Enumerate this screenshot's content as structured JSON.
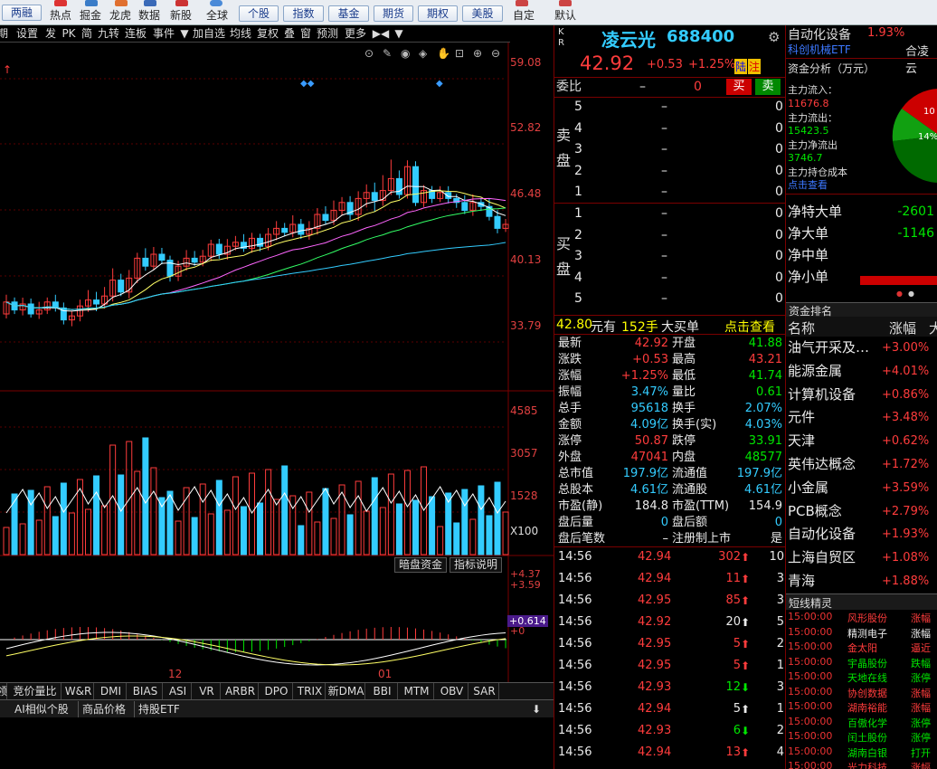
{
  "toolbar": {
    "buttons_left": [
      "两融",
      "热点",
      "掘金",
      "龙虎",
      "数据",
      "新股",
      "全球"
    ],
    "market_buttons": [
      "个股",
      "指数",
      "基金",
      "期货",
      "期权",
      "美股"
    ],
    "buttons_right": [
      "自定",
      "默认"
    ]
  },
  "chart_tabs": [
    "期",
    "设置",
    "发",
    "PK",
    "简",
    "九转",
    "连板",
    "事件",
    "▼",
    "加自选",
    "均线",
    "复权",
    "叠",
    "窗",
    "预测",
    "更多",
    "▶◀",
    "▼"
  ],
  "price_axis": [
    "59.08",
    "52.82",
    "46.48",
    "40.13",
    "33.79"
  ],
  "volume_axis": [
    "4585",
    "3057",
    "1528",
    "X100"
  ],
  "macd_axis": [
    "+4.37",
    "+3.59",
    "+0.614",
    "+0"
  ],
  "macd_buttons": [
    "暗盘资金",
    "指标说明"
  ],
  "date_labels": [
    "12",
    "01"
  ],
  "indicator_tabs": [
    "领",
    "竞价量比",
    "W&R",
    "DMI",
    "BIAS",
    "ASI",
    "VR",
    "ARBR",
    "DPO",
    "TRIX",
    "新DMA",
    "BBI",
    "MTM",
    "OBV",
    "SAR"
  ],
  "bottom_tabs": [
    "AI相似个股",
    "商品价格",
    "持股ETF"
  ],
  "stock": {
    "badge": "K\nR",
    "name": "凌云光",
    "code": "688400",
    "price": "42.92",
    "change": "+0.53",
    "change_pct": "+1.25%",
    "tag1": "陆",
    "tag2": "注"
  },
  "weibi": {
    "label": "委比",
    "dash": "–",
    "value": "0",
    "buy": "买",
    "sell": "卖"
  },
  "sell_label": "卖\n盘",
  "buy_label": "买\n盘",
  "sell_orders": [
    {
      "lvl": "5",
      "price": "–",
      "vol": "0"
    },
    {
      "lvl": "4",
      "price": "–",
      "vol": "0"
    },
    {
      "lvl": "3",
      "price": "–",
      "vol": "0"
    },
    {
      "lvl": "2",
      "price": "–",
      "vol": "0"
    },
    {
      "lvl": "1",
      "price": "–",
      "vol": "0"
    }
  ],
  "buy_orders": [
    {
      "lvl": "1",
      "price": "–",
      "vol": "0"
    },
    {
      "lvl": "2",
      "price": "–",
      "vol": "0"
    },
    {
      "lvl": "3",
      "price": "–",
      "vol": "0"
    },
    {
      "lvl": "4",
      "price": "–",
      "vol": "0"
    },
    {
      "lvl": "5",
      "price": "–",
      "vol": "0"
    }
  ],
  "bigorder": {
    "price": "42.80",
    "unit": "元有",
    "count": "152手",
    "label": "大买单",
    "link": "点击查看"
  },
  "stats": [
    {
      "l1": "最新",
      "v1": "42.92",
      "c1": "red",
      "l2": "开盘",
      "v2": "41.88",
      "c2": "green"
    },
    {
      "l1": "涨跌",
      "v1": "+0.53",
      "c1": "red",
      "l2": "最高",
      "v2": "43.21",
      "c2": "red"
    },
    {
      "l1": "涨幅",
      "v1": "+1.25%",
      "c1": "red",
      "l2": "最低",
      "v2": "41.74",
      "c2": "green"
    },
    {
      "l1": "振幅",
      "v1": "3.47%",
      "c1": "cyan",
      "l2": "量比",
      "v2": "0.61",
      "c2": "green"
    },
    {
      "l1": "总手",
      "v1": "95618",
      "c1": "cyan",
      "l2": "换手",
      "v2": "2.07%",
      "c2": "cyan"
    },
    {
      "l1": "金额",
      "v1": "4.09亿",
      "c1": "cyan",
      "l2": "换手(实)",
      "v2": "4.03%",
      "c2": "cyan"
    },
    {
      "l1": "涨停",
      "v1": "50.87",
      "c1": "red",
      "l2": "跌停",
      "v2": "33.91",
      "c2": "green"
    },
    {
      "l1": "外盘",
      "v1": "47041",
      "c1": "red",
      "l2": "内盘",
      "v2": "48577",
      "c2": "green"
    },
    {
      "l1": "总市值",
      "v1": "197.9亿",
      "c1": "cyan",
      "l2": "流通值",
      "v2": "197.9亿",
      "c2": "cyan"
    },
    {
      "l1": "总股本",
      "v1": "4.61亿",
      "c1": "cyan",
      "l2": "流通股",
      "v2": "4.61亿",
      "c2": "cyan"
    },
    {
      "l1": "市盈(静)",
      "v1": "184.8",
      "c1": "white",
      "l2": "市盈(TTM)",
      "v2": "154.9",
      "c2": "white"
    },
    {
      "l1": "盘后量",
      "v1": "0",
      "c1": "cyan",
      "l2": "盘后额",
      "v2": "0",
      "c2": "cyan"
    },
    {
      "l1": "盘后笔数",
      "v1": "–",
      "c1": "white",
      "l2": "注册制上市",
      "v2": "是",
      "c2": "white"
    }
  ],
  "ticks": [
    {
      "t": "14:56",
      "p": "42.94",
      "c": "red",
      "v": "302",
      "d": "up",
      "n": "10"
    },
    {
      "t": "14:56",
      "p": "42.94",
      "c": "red",
      "v": "11",
      "d": "up",
      "n": "3"
    },
    {
      "t": "14:56",
      "p": "42.95",
      "c": "red",
      "v": "85",
      "d": "up",
      "n": "3"
    },
    {
      "t": "14:56",
      "p": "42.92",
      "c": "red",
      "v": "20",
      "d": "neutral",
      "n": "5"
    },
    {
      "t": "14:56",
      "p": "42.95",
      "c": "red",
      "v": "5",
      "d": "up",
      "n": "2"
    },
    {
      "t": "14:56",
      "p": "42.95",
      "c": "red",
      "v": "5",
      "d": "up",
      "n": "1"
    },
    {
      "t": "14:56",
      "p": "42.93",
      "c": "red",
      "v": "12",
      "d": "down",
      "n": "3"
    },
    {
      "t": "14:56",
      "p": "42.94",
      "c": "red",
      "v": "5",
      "d": "neutral",
      "n": "1"
    },
    {
      "t": "14:56",
      "p": "42.93",
      "c": "red",
      "v": "6",
      "d": "down",
      "n": "2"
    },
    {
      "t": "14:56",
      "p": "42.94",
      "c": "red",
      "v": "13",
      "d": "up",
      "n": "4"
    }
  ],
  "right": {
    "sector": "自动化设备",
    "sector_pct": "1.93%",
    "etf": "科创机械ETF",
    "etf2": "合凌云",
    "fund_title": "资金分析（万元）",
    "inflow_label": "主力流入：",
    "inflow": "11676.8",
    "outflow_label": "主力流出：",
    "outflow": "15423.5",
    "net_label": "主力净流出",
    "net": "3746.7",
    "cost_label": "主力持仓成本",
    "cost_link": "点击查看",
    "pie_labels": [
      "10",
      "14%"
    ],
    "net_rows": [
      {
        "l": "净特大单",
        "v": "-2601"
      },
      {
        "l": "净大单",
        "v": "-1146"
      },
      {
        "l": "净中单",
        "v": ""
      },
      {
        "l": "净小单",
        "v": ""
      }
    ],
    "rank_title": "资金排名",
    "rank_headers": [
      "名称",
      "涨幅",
      "大"
    ],
    "rank_items": [
      {
        "n": "油气开采及…",
        "v": "+3.00%"
      },
      {
        "n": "能源金属",
        "v": "+4.01%"
      },
      {
        "n": "计算机设备",
        "v": "+0.86%"
      },
      {
        "n": "元件",
        "v": "+3.48%"
      },
      {
        "n": "天津",
        "v": "+0.62%"
      },
      {
        "n": "英伟达概念",
        "v": "+1.72%"
      },
      {
        "n": "小金属",
        "v": "+3.59%"
      },
      {
        "n": "PCB概念",
        "v": "+2.79%"
      },
      {
        "n": "自动化设备",
        "v": "+1.93%"
      },
      {
        "n": "上海自贸区",
        "v": "+1.08%"
      },
      {
        "n": "青海",
        "v": "+1.88%"
      }
    ],
    "brief_title": "短线精灵",
    "brief_items": [
      {
        "t": "15:00:00",
        "s": "风形股份",
        "c": "red",
        "e": "涨幅"
      },
      {
        "t": "15:00:00",
        "s": "精测电子",
        "c": "white",
        "e": "涨幅"
      },
      {
        "t": "15:00:00",
        "s": "金太阳",
        "c": "red",
        "e": "逼近"
      },
      {
        "t": "15:00:00",
        "s": "宇晶股份",
        "c": "green",
        "e": "跌幅"
      },
      {
        "t": "15:00:00",
        "s": "天地在线",
        "c": "green",
        "e": "涨停"
      },
      {
        "t": "15:00:00",
        "s": "协创数据",
        "c": "red",
        "e": "涨幅"
      },
      {
        "t": "15:00:00",
        "s": "湖南裕能",
        "c": "red",
        "e": "涨幅"
      },
      {
        "t": "15:00:00",
        "s": "百傲化学",
        "c": "green",
        "e": "涨停"
      },
      {
        "t": "15:00:00",
        "s": "闰土股份",
        "c": "green",
        "e": "涨停"
      },
      {
        "t": "15:00:00",
        "s": "湖南白银",
        "c": "green",
        "e": "打开"
      },
      {
        "t": "15:00:00",
        "s": "光力科技",
        "c": "red",
        "e": "涨幅"
      }
    ]
  },
  "colors": {
    "up": "#ff3c3c",
    "down": "#00e600",
    "cyan": "#33ccff",
    "grid": "#7a0000"
  }
}
